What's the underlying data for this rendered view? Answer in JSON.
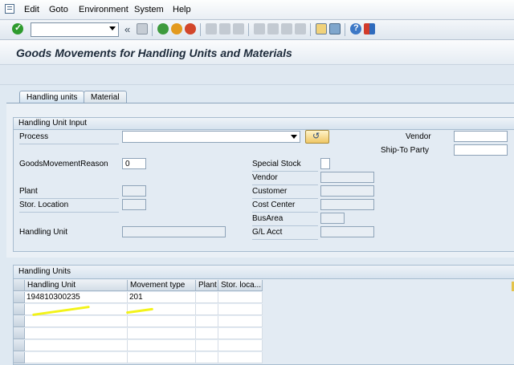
{
  "menubar": {
    "items": [
      {
        "label": "Edit"
      },
      {
        "label": "Goto"
      },
      {
        "label": "Environment"
      },
      {
        "label": "System"
      },
      {
        "label": "Help"
      }
    ]
  },
  "toolbar": {
    "command_field_value": "",
    "back_symbol": "«"
  },
  "page": {
    "title": "Goods Movements for Handling Units and Materials"
  },
  "tabs": [
    {
      "label": "Handling units",
      "active": true
    },
    {
      "label": "Material",
      "active": false
    }
  ],
  "input_group": {
    "title": "Handling Unit Input",
    "process_label": "Process",
    "process_value": "",
    "vendor_label": "Vendor",
    "vendor_value": "",
    "ship_to_label": "Ship-To Party",
    "ship_to_value": "",
    "gm_reason_label": "GoodsMovementReason",
    "gm_reason_value": "0",
    "special_stock_label": "Special Stock",
    "vendor2_label": "Vendor",
    "customer_label": "Customer",
    "plant_label": "Plant",
    "cost_center_label": "Cost Center",
    "stor_location_label": "Stor. Location",
    "bus_area_label": "BusArea",
    "handling_unit_label": "Handling Unit",
    "gl_acct_label": "G/L Acct"
  },
  "hu_table": {
    "title": "Handling Units",
    "columns": [
      "Handling Unit",
      "Movement type",
      "Plant",
      "Stor. loca..."
    ],
    "rows": [
      [
        "194810300235",
        "201",
        "",
        ""
      ]
    ]
  },
  "colors": {
    "highlight": "#f2f200",
    "accent": "#1c2a3a"
  }
}
